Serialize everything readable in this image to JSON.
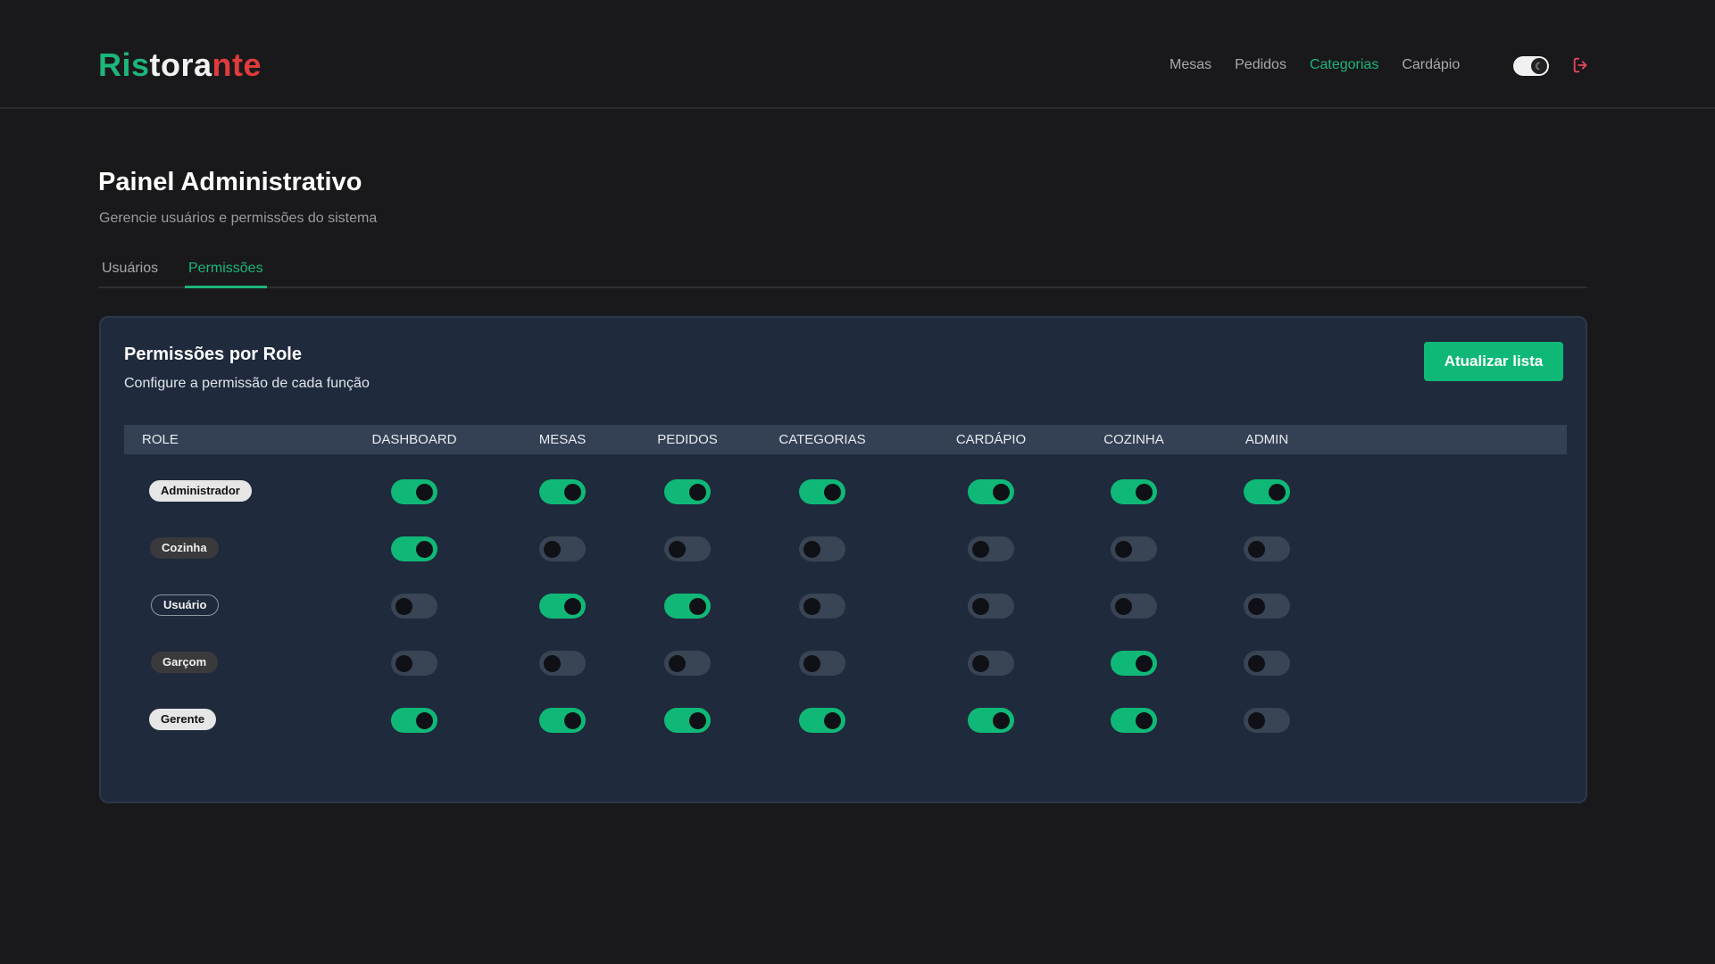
{
  "brand": {
    "part1": "Ris",
    "part2": "tora",
    "part3": "nte"
  },
  "nav": [
    {
      "label": "Mesas",
      "active": false
    },
    {
      "label": "Pedidos",
      "active": false
    },
    {
      "label": "Categorias",
      "active": true
    },
    {
      "label": "Cardápio",
      "active": false
    }
  ],
  "page": {
    "title": "Painel Administrativo",
    "subtitle": "Gerencie usuários e permissões do sistema"
  },
  "tabs": [
    {
      "label": "Usuários",
      "active": false
    },
    {
      "label": "Permissões",
      "active": true
    }
  ],
  "card": {
    "title": "Permissões por Role",
    "subtitle": "Configure a permissão de cada função",
    "refresh_label": "Atualizar lista"
  },
  "table": {
    "columns": [
      "ROLE",
      "DASHBOARD",
      "MESAS",
      "PEDIDOS",
      "CATEGORIAS",
      "CARDÁPIO",
      "COZINHA",
      "ADMIN"
    ],
    "rows": [
      {
        "role": "Administrador",
        "style": "light",
        "perms": [
          true,
          true,
          true,
          true,
          true,
          true,
          true
        ]
      },
      {
        "role": "Cozinha",
        "style": "dark",
        "perms": [
          true,
          false,
          false,
          false,
          false,
          false,
          false
        ]
      },
      {
        "role": "Usuário",
        "style": "outline",
        "perms": [
          false,
          true,
          true,
          false,
          false,
          false,
          false
        ]
      },
      {
        "role": "Garçom",
        "style": "dark",
        "perms": [
          false,
          false,
          false,
          false,
          false,
          true,
          false
        ]
      },
      {
        "role": "Gerente",
        "style": "light",
        "perms": [
          true,
          true,
          true,
          true,
          true,
          true,
          false
        ]
      }
    ]
  },
  "colors": {
    "accent": "#10b877",
    "danger": "#e23b3b",
    "card_bg": "#1f2a3c",
    "page_bg": "#19191b"
  },
  "icons": {
    "theme": "moon-icon",
    "logout": "logout-icon"
  }
}
